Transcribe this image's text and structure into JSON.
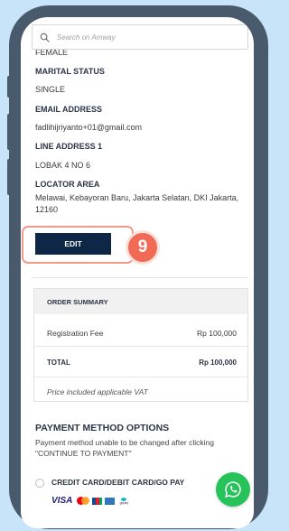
{
  "search": {
    "placeholder": "Search on Amway"
  },
  "profile": {
    "gender_value": "FEMALE",
    "marital_status_label": "MARITAL STATUS",
    "marital_status_value": "SINGLE",
    "email_label": "EMAIL ADDRESS",
    "email_value": "fadlihijriyanto+01@gmail.com",
    "line_address_label": "LINE ADDRESS 1",
    "line_address_value": "LOBAK 4 NO 6",
    "locator_label": "LOCATOR AREA",
    "locator_value": "Melawai, Kebayoran Baru, Jakarta Selatan, DKI Jakarta, 12160",
    "edit_label": "EDIT"
  },
  "step_badge": "9",
  "order_summary": {
    "title": "ORDER SUMMARY",
    "rows": [
      {
        "label": "Registration Fee",
        "value": "Rp 100,000"
      }
    ],
    "total_label": "TOTAL",
    "total_value": "Rp 100,000",
    "note": "Price included applicable VAT"
  },
  "payment": {
    "title": "PAYMENT METHOD OPTIONS",
    "note": "Payment method unable to be changed after clicking \"CONTINUE TO PAYMENT\"",
    "option_label": "CREDIT CARD/DEBIT CARD/GO PAY",
    "card_logos": [
      "VISA",
      "mastercard-icon",
      "jcb-icon",
      "amex-icon",
      "gopay-icon"
    ],
    "visa_text": "VISA",
    "gopay_text": "gopay"
  },
  "colors": {
    "background": "#c8e4f8",
    "phone_frame": "#4a5a6d",
    "edit_button": "#0f2747",
    "step_badge": "#f06a55",
    "whatsapp": "#25c35a"
  }
}
